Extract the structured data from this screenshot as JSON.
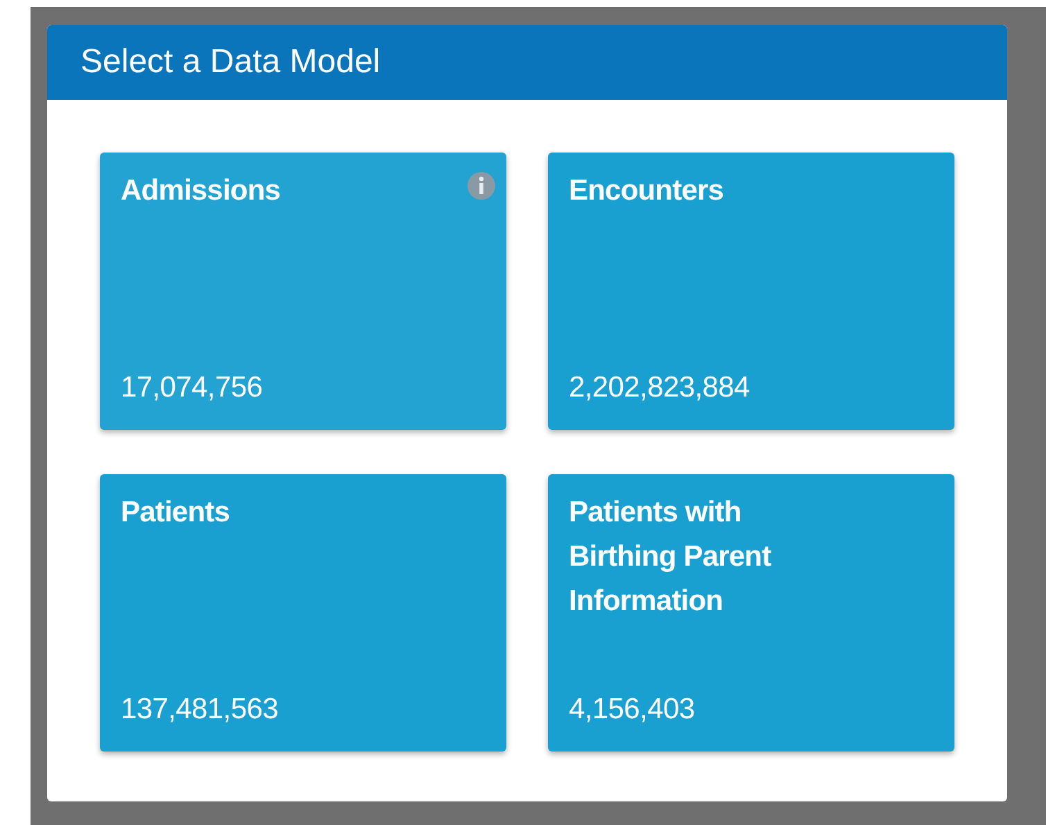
{
  "dialog": {
    "title": "Select a Data Model"
  },
  "models": [
    {
      "name": "Admissions",
      "count": "17,074,756",
      "info": true
    },
    {
      "name": "Encounters",
      "count": "2,202,823,884",
      "info": false
    },
    {
      "name": "Patients",
      "count": "137,481,563",
      "info": false
    },
    {
      "name": "Patients with Birthing Parent Information",
      "count": "4,156,403",
      "info": false
    }
  ]
}
